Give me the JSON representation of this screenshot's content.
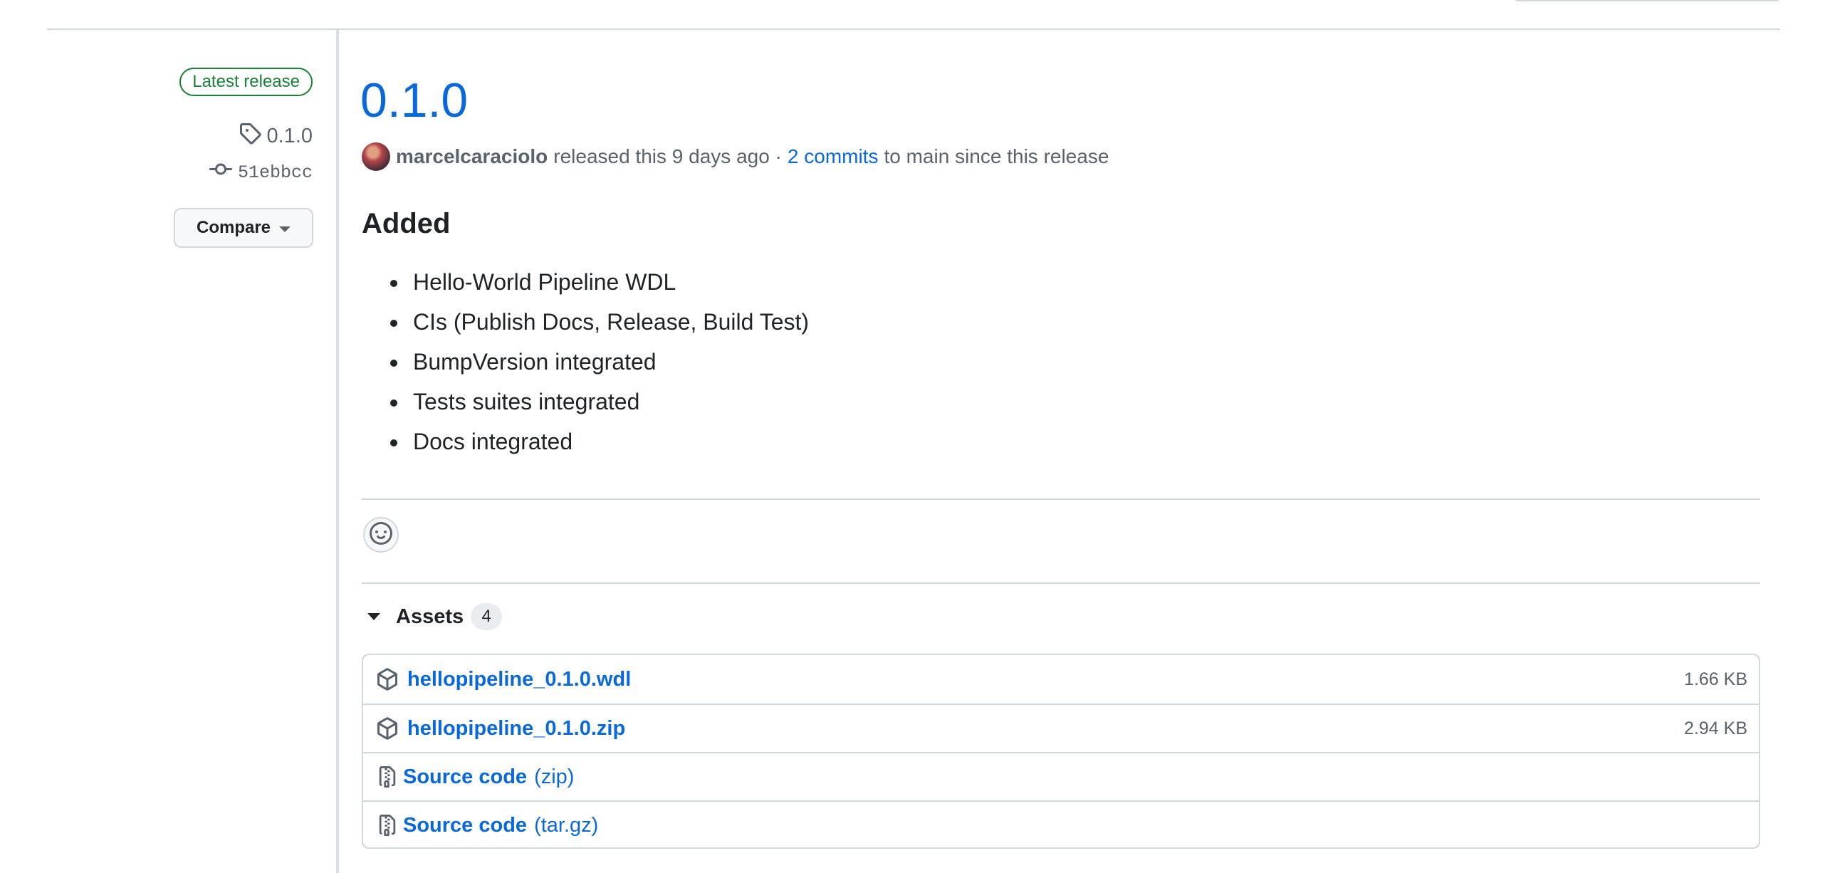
{
  "sidebar": {
    "badge": "Latest release",
    "tag": "0.1.0",
    "commit": "51ebbcc",
    "compare_label": "Compare"
  },
  "release": {
    "title": "0.1.0",
    "author": "marcelcaraciolo",
    "released_text": "released this 9 days ago ·",
    "commits_link": "2 commits",
    "commits_suffix": "to main since this release",
    "section_heading": "Added",
    "notes": [
      "Hello-World Pipeline WDL",
      "CIs (Publish Docs, Release, Build Test)",
      "BumpVersion integrated",
      "Tests suites integrated",
      "Docs integrated"
    ]
  },
  "assets": {
    "label": "Assets",
    "count": "4",
    "items": [
      {
        "name": "hellopipeline_0.1.0.wdl",
        "size": "1.66 KB",
        "icon": "package-icon"
      },
      {
        "name": "hellopipeline_0.1.0.zip",
        "size": "2.94 KB",
        "icon": "package-icon"
      },
      {
        "name": "Source code",
        "suffix": "(zip)",
        "icon": "file-zip-icon"
      },
      {
        "name": "Source code",
        "suffix": "(tar.gz)",
        "icon": "file-zip-icon"
      }
    ]
  },
  "colors": {
    "link": "#0969da",
    "badge_green": "#1a7f37",
    "muted": "#59636e",
    "border": "#d0d7de"
  }
}
